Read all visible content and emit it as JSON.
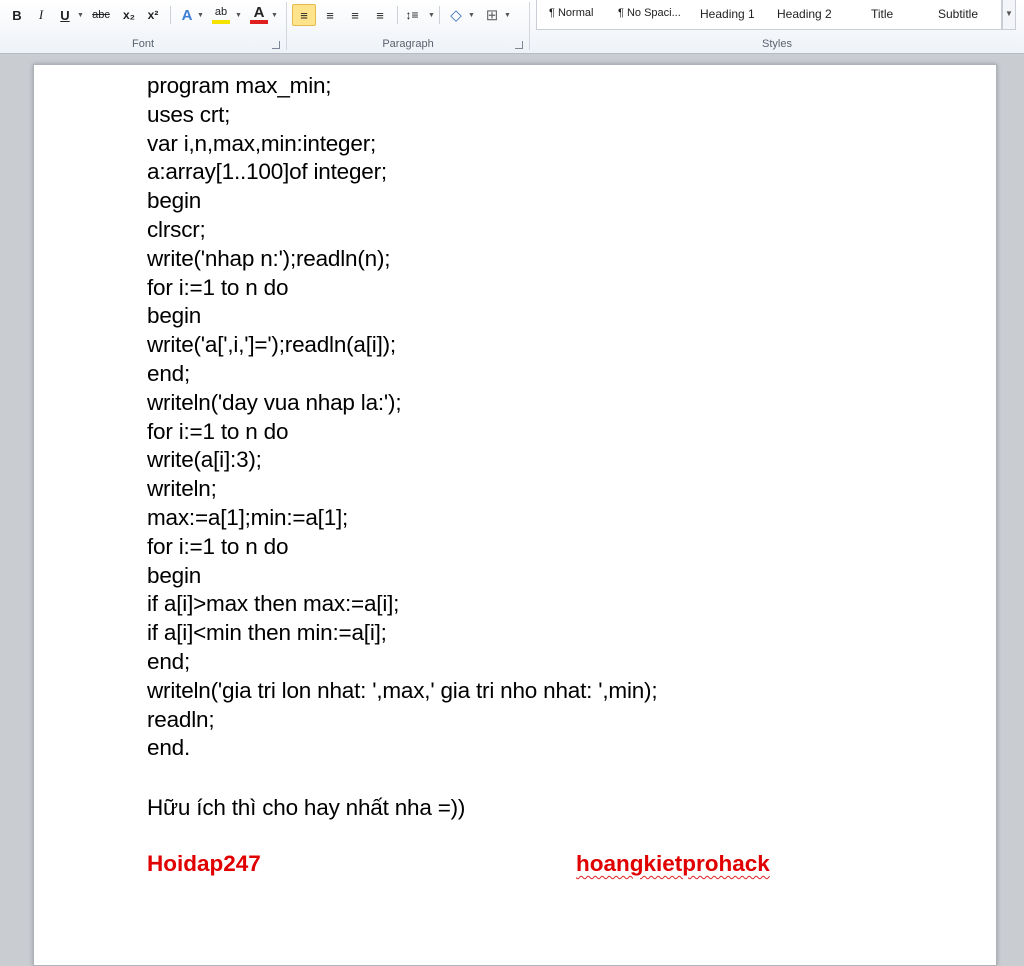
{
  "ribbon": {
    "font_group": {
      "label": "Font",
      "buttons": [
        {
          "key": "bold",
          "glyph": "B"
        },
        {
          "key": "italic",
          "glyph": "I"
        },
        {
          "key": "underline",
          "glyph": "U"
        },
        {
          "key": "strike",
          "glyph": "abc"
        },
        {
          "key": "subscript",
          "glyph": "x₂"
        },
        {
          "key": "superscript",
          "glyph": "x²"
        },
        {
          "key": "text-effects",
          "glyph": "A"
        },
        {
          "key": "highlight",
          "glyph": "ab"
        },
        {
          "key": "font-color",
          "glyph": "A"
        }
      ]
    },
    "paragraph_group": {
      "label": "Paragraph",
      "buttons": [
        {
          "key": "align-left",
          "glyph": "≡"
        },
        {
          "key": "align-center",
          "glyph": "≡"
        },
        {
          "key": "align-right",
          "glyph": "≡"
        },
        {
          "key": "justify",
          "glyph": "≡"
        },
        {
          "key": "line-spacing",
          "glyph": "↕≡"
        },
        {
          "key": "shading",
          "glyph": "◇"
        },
        {
          "key": "borders",
          "glyph": "⊞"
        }
      ]
    },
    "styles_group": {
      "label": "Styles",
      "items": [
        {
          "label": "¶ Normal"
        },
        {
          "label": "¶ No Spaci..."
        },
        {
          "label": "Heading 1"
        },
        {
          "label": "Heading 2"
        },
        {
          "label": "Title"
        },
        {
          "label": "Subtitle"
        }
      ]
    }
  },
  "document": {
    "code_lines": [
      "program max_min;",
      "uses crt;",
      "var i,n,max,min:integer;",
      "a:array[1..100]of integer;",
      "begin",
      "clrscr;",
      "write('nhap n:');readln(n);",
      "for i:=1 to n do",
      "begin",
      "write('a[',i,']=');readln(a[i]);",
      "end;",
      "writeln('day vua nhap la:');",
      "for i:=1 to n do",
      "write(a[i]:3);",
      "writeln;",
      "max:=a[1];min:=a[1];",
      "for i:=1 to n do",
      "begin",
      "if a[i]>max then max:=a[i];",
      "if a[i]<min then min:=a[i];",
      "end;",
      "writeln('gia tri lon nhat: ',max,' gia tri nho nhat: ',min);",
      "readln;",
      "end."
    ],
    "note": "Hữu ích thì cho hay nhất nha =))",
    "signature_left": "Hoidap247",
    "signature_right": "hoangkietprohack"
  },
  "colors": {
    "signature_red": "#e00000",
    "active_button": "#fde38b"
  }
}
